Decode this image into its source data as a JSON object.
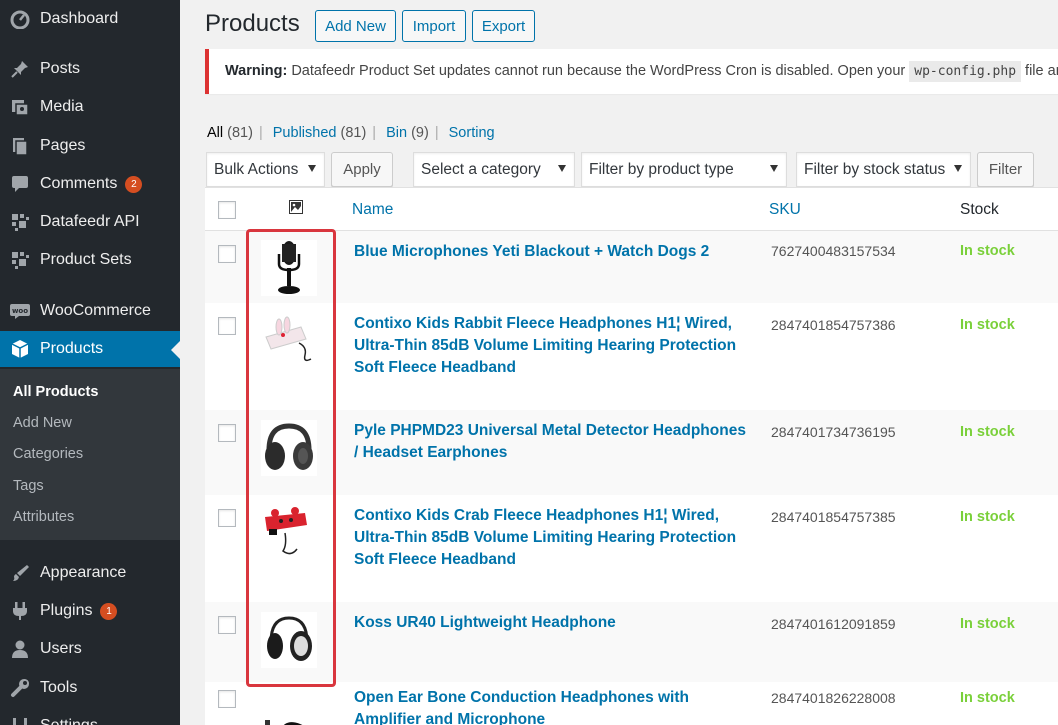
{
  "sidebar": {
    "items": [
      {
        "label": "Dashboard",
        "icon": "dashboard-icon"
      },
      {
        "label": "Posts",
        "icon": "pin-icon"
      },
      {
        "label": "Media",
        "icon": "media-icon"
      },
      {
        "label": "Pages",
        "icon": "pages-icon"
      },
      {
        "label": "Comments",
        "icon": "comments-icon",
        "badge": "2"
      },
      {
        "label": "Datafeedr API",
        "icon": "datafeedr-icon"
      },
      {
        "label": "Product Sets",
        "icon": "datafeedr-icon"
      },
      {
        "label": "WooCommerce",
        "icon": "woocommerce-icon"
      },
      {
        "label": "Products",
        "icon": "products-icon"
      },
      {
        "label": "Appearance",
        "icon": "brush-icon"
      },
      {
        "label": "Plugins",
        "icon": "plugin-icon",
        "badge": "1"
      },
      {
        "label": "Users",
        "icon": "users-icon"
      },
      {
        "label": "Tools",
        "icon": "wrench-icon"
      },
      {
        "label": "Settings",
        "icon": "settings-icon"
      }
    ],
    "submenu": [
      "All Products",
      "Add New",
      "Categories",
      "Tags",
      "Attributes"
    ]
  },
  "header": {
    "title": "Products",
    "buttons": [
      "Add New",
      "Import",
      "Export"
    ]
  },
  "notice": {
    "strong": "Warning:",
    "text": " Datafeedr Product Set updates cannot run because the WordPress Cron is disabled. Open your ",
    "code": "wp-config.php",
    "tail": " file and"
  },
  "views": [
    {
      "label": "All",
      "count": "(81)"
    },
    {
      "label": "Published",
      "count": "(81)"
    },
    {
      "label": "Bin",
      "count": "(9)"
    },
    {
      "label": "Sorting",
      "count": ""
    }
  ],
  "filters": {
    "bulk_actions": "Bulk Actions",
    "apply": "Apply",
    "category": "Select a category",
    "product_type": "Filter by product type",
    "stock_status": "Filter by stock status",
    "filter": "Filter"
  },
  "table": {
    "columns": {
      "name": "Name",
      "sku": "SKU",
      "stock": "Stock"
    },
    "rows": [
      {
        "name": "Blue Microphones Yeti Blackout + Watch Dogs 2",
        "sku": "7627400483157534",
        "stock": "In stock",
        "thumb": "microphone"
      },
      {
        "name": "Contixo Kids Rabbit Fleece Headphones H1¦ Wired, Ultra-Thin 85dB Volume Limiting Hearing Protection Soft Fleece Headband",
        "sku": "2847401854757386",
        "stock": "In stock",
        "thumb": "rabbit-headband"
      },
      {
        "name": "Pyle PHPMD23 Universal Metal Detector Headphones / Headset Earphones",
        "sku": "2847401734736195",
        "stock": "In stock",
        "thumb": "headphones-black"
      },
      {
        "name": "Contixo Kids Crab Fleece Headphones H1¦ Wired, Ultra-Thin 85dB Volume Limiting Hearing Protection Soft Fleece Headband",
        "sku": "2847401854757385",
        "stock": "In stock",
        "thumb": "crab-headband"
      },
      {
        "name": "Koss UR40 Lightweight Headphone",
        "sku": "2847401612091859",
        "stock": "In stock",
        "thumb": "headphones-silver"
      },
      {
        "name": "Open Ear Bone Conduction Headphones with Amplifier and Microphone",
        "sku": "2847401826228008",
        "stock": "In stock",
        "thumb": "bone-conduction"
      }
    ]
  },
  "colors": {
    "sidebar_bg": "#23282d",
    "active": "#0073aa",
    "link": "#0073aa",
    "in_stock": "#7ad03a",
    "highlight": "#d9363e"
  }
}
